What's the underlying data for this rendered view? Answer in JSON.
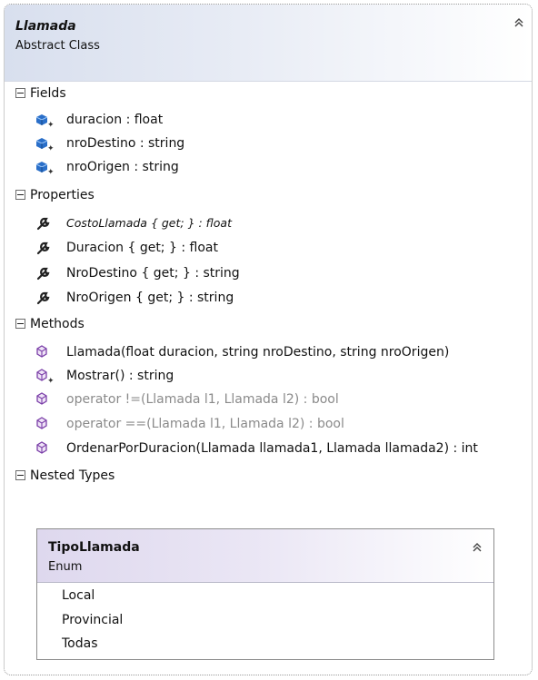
{
  "class": {
    "name": "Llamada",
    "kind": "Abstract Class",
    "collapse_glyph": "collapse-double-chevron-icon"
  },
  "sections": {
    "fields": {
      "label": "Fields",
      "items": [
        {
          "text": "duracion : float",
          "icon": "field-private-icon"
        },
        {
          "text": "nroDestino : string",
          "icon": "field-private-icon"
        },
        {
          "text": "nroOrigen : string",
          "icon": "field-private-icon"
        }
      ]
    },
    "properties": {
      "label": "Properties",
      "items": [
        {
          "text": "CostoLlamada { get; } : float",
          "icon": "property-wrench-icon",
          "style": "italic-abstract"
        },
        {
          "text": "Duracion { get; } : float",
          "icon": "property-wrench-icon"
        },
        {
          "text": "NroDestino { get; } : string",
          "icon": "property-wrench-icon"
        },
        {
          "text": "NroOrigen { get; } : string",
          "icon": "property-wrench-icon"
        }
      ]
    },
    "methods": {
      "label": "Methods",
      "items": [
        {
          "text": "Llamada(float duracion, string nroDestino, string nroOrigen)",
          "icon": "method-icon"
        },
        {
          "text": "Mostrar() : string",
          "icon": "method-private-icon"
        },
        {
          "text": "operator !=(Llamada l1, Llamada l2) : bool",
          "icon": "method-icon",
          "style": "greyed"
        },
        {
          "text": "operator ==(Llamada l1, Llamada l2) : bool",
          "icon": "method-icon",
          "style": "greyed"
        },
        {
          "text": "OrdenarPorDuracion(Llamada llamada1, Llamada llamada2) : int",
          "icon": "method-icon"
        }
      ]
    },
    "nested_types": {
      "label": "Nested Types"
    }
  },
  "nested_enum": {
    "name": "TipoLlamada",
    "kind": "Enum",
    "values": [
      "Local",
      "Provincial",
      "Todas"
    ]
  },
  "colors": {
    "class_header": "#d8dfee",
    "enum_header": "#ded8ee",
    "field_icon": "#2a6fc9",
    "method_icon": "#7b3fa8"
  }
}
